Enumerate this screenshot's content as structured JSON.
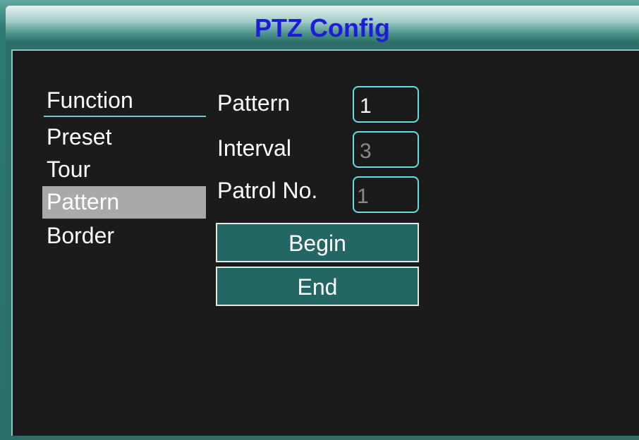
{
  "window": {
    "title": "PTZ Config"
  },
  "menu": {
    "header": "Function",
    "items": [
      {
        "label": "Preset",
        "selected": false
      },
      {
        "label": "Tour",
        "selected": false
      },
      {
        "label": "Pattern",
        "selected": true
      },
      {
        "label": "Border",
        "selected": false
      }
    ]
  },
  "form": {
    "pattern": {
      "label": "Pattern",
      "value": "1"
    },
    "interval": {
      "label": "Interval",
      "value": "3"
    },
    "patrol_no": {
      "label": "Patrol No.",
      "value": "1"
    },
    "begin_label": "Begin",
    "end_label": "End"
  },
  "colors": {
    "title_text": "#1d1dd8",
    "panel_bg": "#1b1b1b",
    "frame_teal": "#2c6f68",
    "field_border": "#66e0e6",
    "button_bg": "#236764",
    "selected_bg": "#a9a9a9"
  }
}
